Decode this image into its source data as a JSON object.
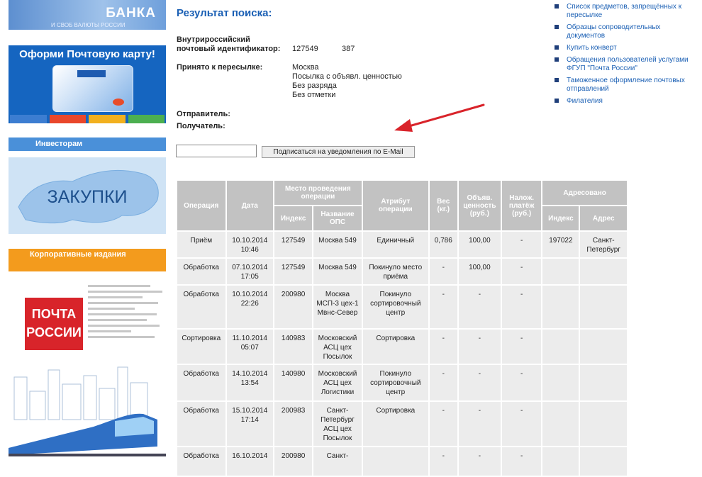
{
  "sidebar": {
    "bank_banner": {
      "title": "БАНКА",
      "subtitle": "И СВОБ ВАЛЮТЫ РОССИИ"
    },
    "card_banner": {
      "title": "Оформи Почтовую карту!"
    },
    "investors_heading": "Инвесторам",
    "zakupki_label": "ЗАКУПКИ",
    "corporate_heading": "Корпоративные издания",
    "pochta_logo": "ПОЧТА РОССИИ"
  },
  "main": {
    "title": "Результат поиска:",
    "identifier": {
      "label": "Внутрироссийский почтовый идентификатор:",
      "value": "127549",
      "suffix": "387"
    },
    "accepted": {
      "label": "Принято к пересылке:",
      "lines": [
        "Москва",
        "Посылка с объявл. ценностью",
        "Без разряда",
        "Без отметки"
      ]
    },
    "sender_label": "Отправитель:",
    "recipient_label": "Получатель:",
    "subscribe_button": "Подписаться на уведомления по E-Mail",
    "email_placeholder": ""
  },
  "table": {
    "headers": {
      "operation": "Операция",
      "date": "Дата",
      "place_group": "Место проведения операции",
      "index": "Индекс",
      "ops_name": "Название ОПС",
      "attribute": "Атрибут операции",
      "weight": "Вес (кг.)",
      "declared_value": "Объяв. ценность (руб.)",
      "cod": "Налож. платёж (руб.)",
      "addressed_group": "Адресовано",
      "addr_index": "Индекс",
      "address": "Адрес"
    },
    "rows": [
      {
        "op": "Приём",
        "date": "10.10.2014 10:46",
        "index": "127549",
        "ops": "Москва 549",
        "attr": "Единичный",
        "weight": "0,786",
        "value": "100,00",
        "cod": "-",
        "addr_index": "197022",
        "address": "Санкт-Петербург"
      },
      {
        "op": "Обработка",
        "date": "07.10.2014 17:05",
        "index": "127549",
        "ops": "Москва 549",
        "attr": "Покинуло место приёма",
        "weight": "-",
        "value": "100,00",
        "cod": "-",
        "addr_index": "",
        "address": ""
      },
      {
        "op": "Обработка",
        "date": "10.10.2014 22:26",
        "index": "200980",
        "ops": "Москва МСП-3 цех-1 Мвнс-Север",
        "attr": "Покинуло сортировочный центр",
        "weight": "-",
        "value": "-",
        "cod": "-",
        "addr_index": "",
        "address": ""
      },
      {
        "op": "Сортировка",
        "date": "11.10.2014 05:07",
        "index": "140983",
        "ops": "Московский АСЦ цех Посылок",
        "attr": "Сортировка",
        "weight": "-",
        "value": "-",
        "cod": "-",
        "addr_index": "",
        "address": ""
      },
      {
        "op": "Обработка",
        "date": "14.10.2014 13:54",
        "index": "140980",
        "ops": "Московский АСЦ цех Логистики",
        "attr": "Покинуло сортировочный центр",
        "weight": "-",
        "value": "-",
        "cod": "-",
        "addr_index": "",
        "address": ""
      },
      {
        "op": "Обработка",
        "date": "15.10.2014 17:14",
        "index": "200983",
        "ops": "Санкт-Петербург АСЦ цех Посылок",
        "attr": "Сортировка",
        "weight": "-",
        "value": "-",
        "cod": "-",
        "addr_index": "",
        "address": ""
      },
      {
        "op": "Обработка",
        "date": "16.10.2014",
        "index": "200980",
        "ops": "Санкт-",
        "attr": "",
        "weight": "-",
        "value": "-",
        "cod": "-",
        "addr_index": "",
        "address": ""
      }
    ]
  },
  "right_links": [
    "Список предметов, запрещённых к пересылке",
    "Образцы сопроводительных документов",
    "Купить конверт",
    "Обращения пользователей услугами ФГУП \"Почта России\"",
    "Таможенное оформление почтовых отправлений",
    "Филателия"
  ],
  "colors": {
    "accent": "#1a5fb4",
    "header_gray": "#c2c2c2",
    "cell_gray": "#ececec",
    "arrow": "#d9232a",
    "orange": "#f39b1d"
  }
}
